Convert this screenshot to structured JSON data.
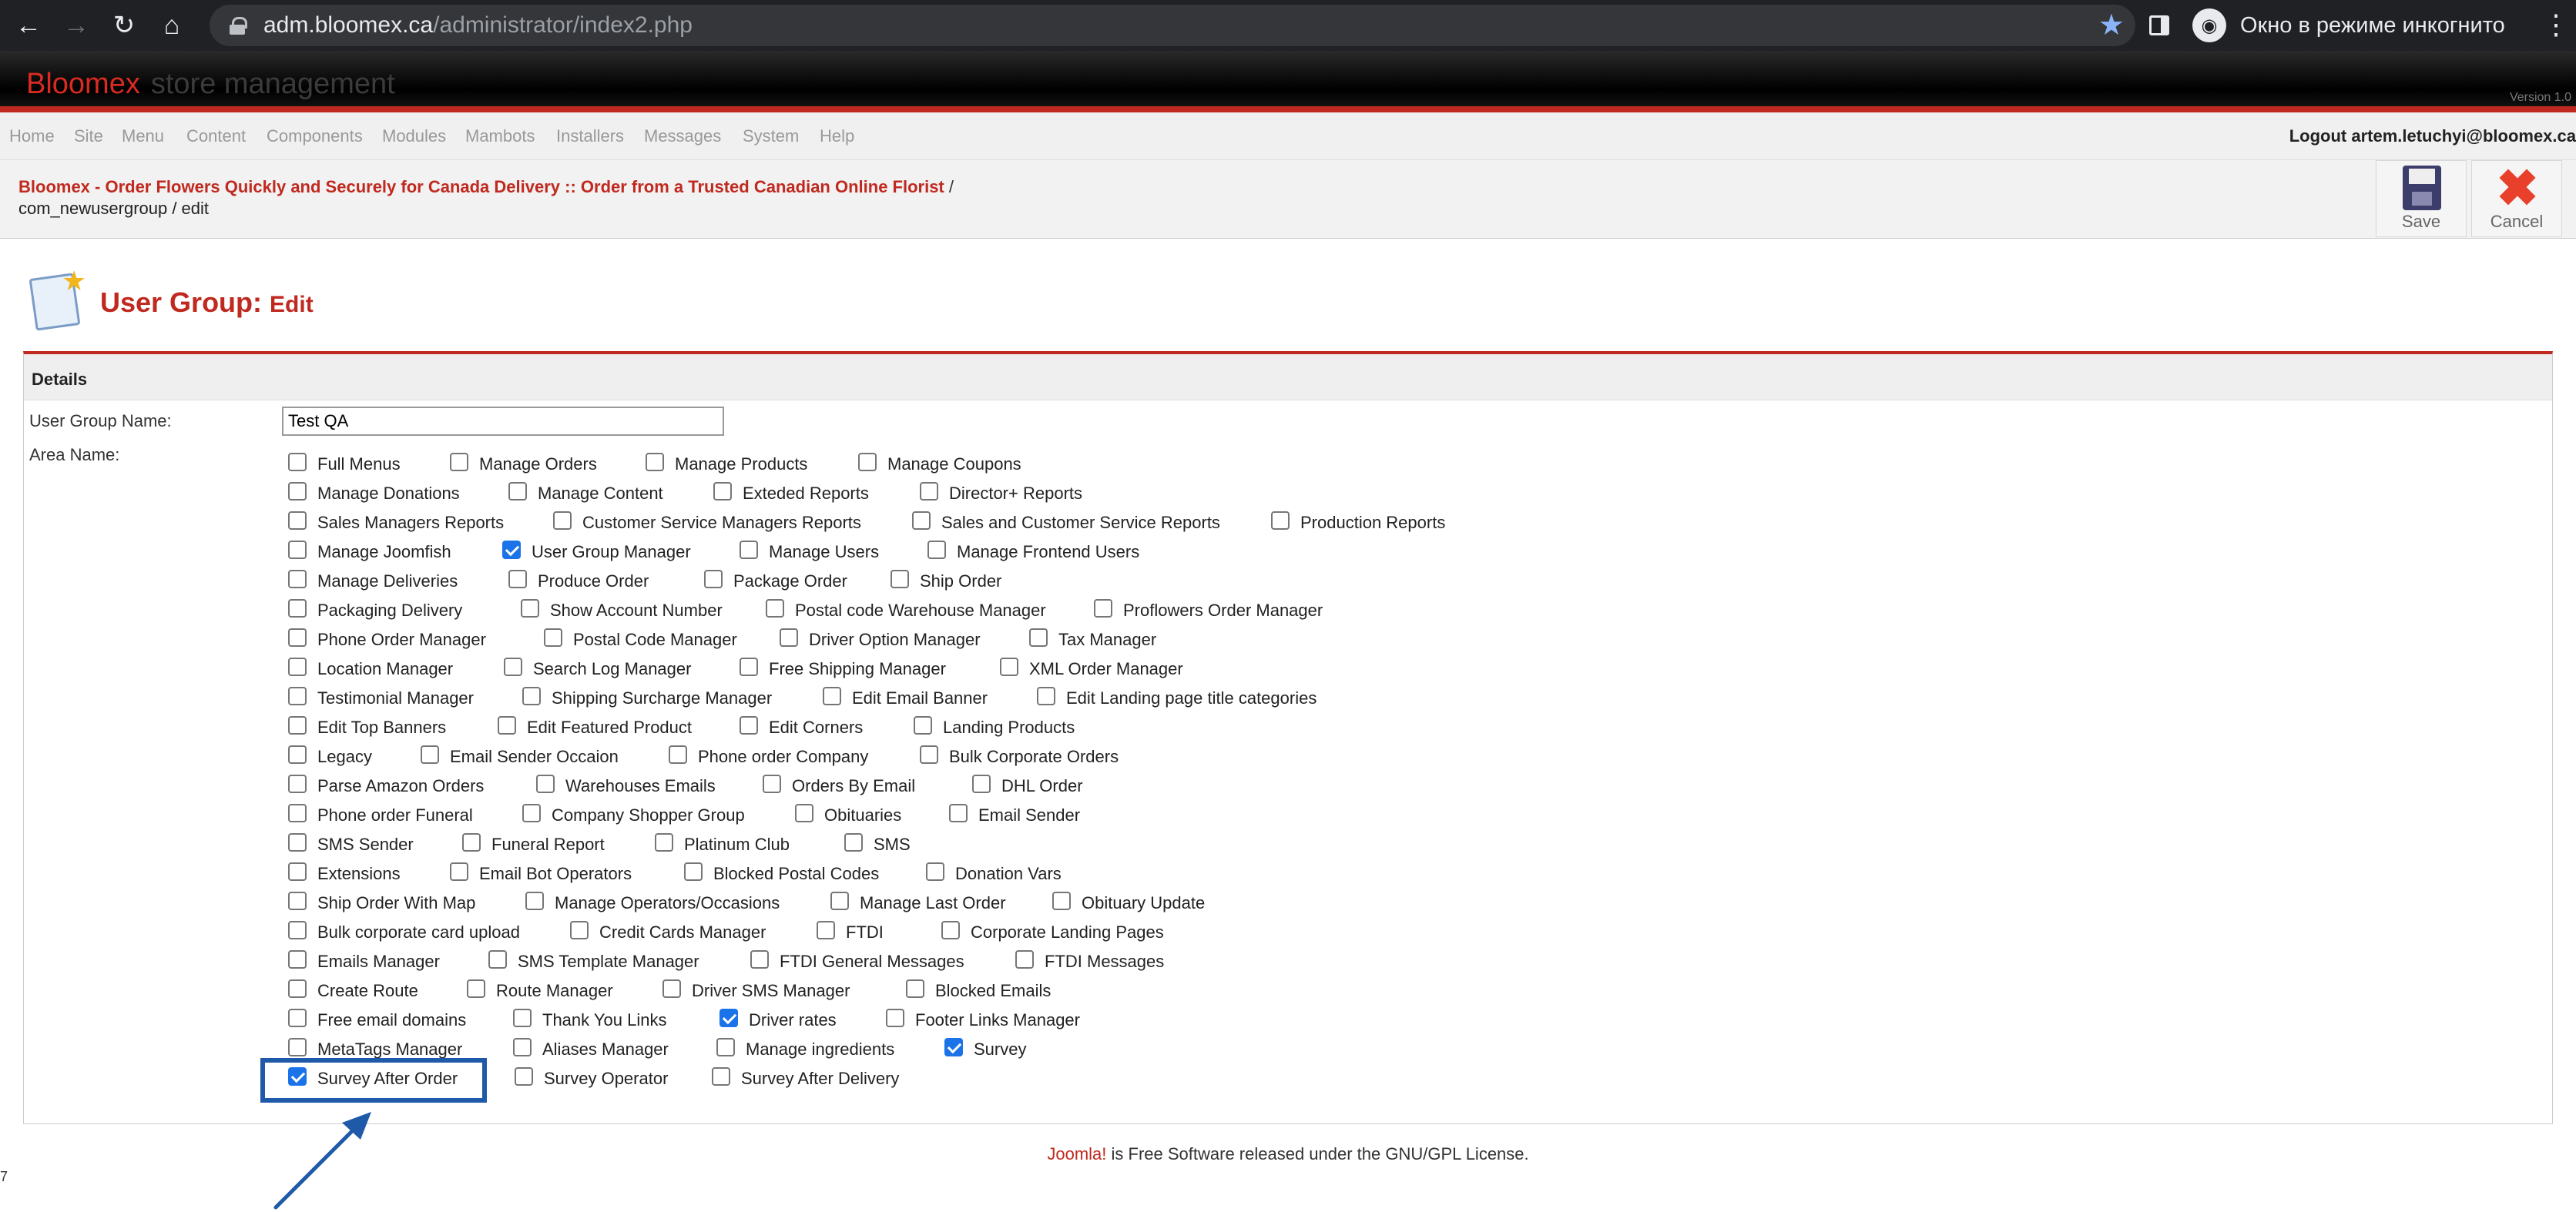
{
  "browser": {
    "url_host": "adm.bloomex.ca",
    "url_path": "/administrator/index2.php",
    "incognito_label": "Окно в режиме инкогнито"
  },
  "header": {
    "brand": "Bloomex",
    "brand_sub": "store management",
    "version": "Version 1.0"
  },
  "menu": {
    "items": [
      "Home",
      "Site",
      "Menu",
      "Content",
      "Components",
      "Modules",
      "Mambots",
      "Installers",
      "Messages",
      "System",
      "Help"
    ],
    "logout": "Logout artem.letuchyi@bloomex.ca"
  },
  "pathway": {
    "site_link": "Bloomex - Order Flowers Quickly and Securely for Canada Delivery :: Order from a Trusted Canadian Online Florist",
    "separator": "/",
    "current": "com_newusergroup / edit"
  },
  "toolbar": {
    "save": "Save",
    "cancel": "Cancel"
  },
  "page": {
    "title": "User Group:",
    "subtitle": "Edit"
  },
  "form": {
    "section": "Details",
    "name_label": "User Group Name:",
    "name_value": "Test QA",
    "area_label": "Area Name:",
    "rows": [
      [
        {
          "label": "Full Menus",
          "checked": false
        },
        {
          "label": "Manage Orders",
          "checked": false
        },
        {
          "label": "Manage Products",
          "checked": false
        },
        {
          "label": "Manage Coupons",
          "checked": false
        }
      ],
      [
        {
          "label": "Manage Donations",
          "checked": false
        },
        {
          "label": "Manage Content",
          "checked": false
        },
        {
          "label": "Exteded Reports",
          "checked": false
        },
        {
          "label": "Director+ Reports",
          "checked": false
        }
      ],
      [
        {
          "label": "Sales Managers Reports",
          "checked": false
        },
        {
          "label": "Customer Service Managers Reports",
          "checked": false
        },
        {
          "label": "Sales and Customer Service Reports",
          "checked": false
        },
        {
          "label": "Production Reports",
          "checked": false
        }
      ],
      [
        {
          "label": "Manage Joomfish",
          "checked": false
        },
        {
          "label": "User Group Manager",
          "checked": true
        },
        {
          "label": "Manage Users",
          "checked": false
        },
        {
          "label": "Manage Frontend Users",
          "checked": false
        }
      ],
      [
        {
          "label": "Manage Deliveries",
          "checked": false
        },
        {
          "label": "Produce Order",
          "checked": false
        },
        {
          "label": "Package Order",
          "checked": false
        },
        {
          "label": "Ship Order",
          "checked": false
        }
      ],
      [
        {
          "label": "Packaging Delivery",
          "checked": false
        },
        {
          "label": "Show Account Number",
          "checked": false
        },
        {
          "label": "Postal code Warehouse Manager",
          "checked": false
        },
        {
          "label": "Proflowers Order Manager",
          "checked": false
        }
      ],
      [
        {
          "label": "Phone Order Manager",
          "checked": false
        },
        {
          "label": "Postal Code Manager",
          "checked": false
        },
        {
          "label": "Driver Option Manager",
          "checked": false
        },
        {
          "label": "Tax Manager",
          "checked": false
        }
      ],
      [
        {
          "label": "Location Manager",
          "checked": false
        },
        {
          "label": "Search Log Manager",
          "checked": false
        },
        {
          "label": "Free Shipping Manager",
          "checked": false
        },
        {
          "label": "XML Order Manager",
          "checked": false
        }
      ],
      [
        {
          "label": "Testimonial Manager",
          "checked": false
        },
        {
          "label": "Shipping Surcharge Manager",
          "checked": false
        },
        {
          "label": "Edit Email Banner",
          "checked": false
        },
        {
          "label": "Edit Landing page title categories",
          "checked": false
        }
      ],
      [
        {
          "label": "Edit Top Banners",
          "checked": false
        },
        {
          "label": "Edit Featured Product",
          "checked": false
        },
        {
          "label": "Edit Corners",
          "checked": false
        },
        {
          "label": "Landing Products",
          "checked": false
        }
      ],
      [
        {
          "label": "Legacy",
          "checked": false
        },
        {
          "label": "Email Sender Occaion",
          "checked": false
        },
        {
          "label": "Phone order Company",
          "checked": false
        },
        {
          "label": "Bulk Corporate Orders",
          "checked": false
        }
      ],
      [
        {
          "label": "Parse Amazon Orders",
          "checked": false
        },
        {
          "label": "Warehouses Emails",
          "checked": false
        },
        {
          "label": "Orders By Email",
          "checked": false
        },
        {
          "label": "DHL Order",
          "checked": false
        }
      ],
      [
        {
          "label": "Phone order Funeral",
          "checked": false
        },
        {
          "label": "Company Shopper Group",
          "checked": false
        },
        {
          "label": "Obituaries",
          "checked": false
        },
        {
          "label": "Email Sender",
          "checked": false
        }
      ],
      [
        {
          "label": "SMS Sender",
          "checked": false
        },
        {
          "label": "Funeral Report",
          "checked": false
        },
        {
          "label": "Platinum Club",
          "checked": false
        },
        {
          "label": "SMS",
          "checked": false
        }
      ],
      [
        {
          "label": "Extensions",
          "checked": false
        },
        {
          "label": "Email Bot Operators",
          "checked": false
        },
        {
          "label": "Blocked Postal Codes",
          "checked": false
        },
        {
          "label": "Donation Vars",
          "checked": false
        }
      ],
      [
        {
          "label": "Ship Order With Map",
          "checked": false
        },
        {
          "label": "Manage Operators/Occasions",
          "checked": false
        },
        {
          "label": "Manage Last Order",
          "checked": false
        },
        {
          "label": "Obituary Update",
          "checked": false
        }
      ],
      [
        {
          "label": "Bulk corporate card upload",
          "checked": false
        },
        {
          "label": "Credit Cards Manager",
          "checked": false
        },
        {
          "label": "FTDI",
          "checked": false
        },
        {
          "label": "Corporate Landing Pages",
          "checked": false
        }
      ],
      [
        {
          "label": "Emails Manager",
          "checked": false
        },
        {
          "label": "SMS Template Manager",
          "checked": false
        },
        {
          "label": "FTDI General Messages",
          "checked": false
        },
        {
          "label": "FTDI Messages",
          "checked": false
        }
      ],
      [
        {
          "label": "Create Route",
          "checked": false
        },
        {
          "label": "Route Manager",
          "checked": false
        },
        {
          "label": "Driver SMS Manager",
          "checked": false
        },
        {
          "label": "Blocked Emails",
          "checked": false
        }
      ],
      [
        {
          "label": "Free email domains",
          "checked": false
        },
        {
          "label": "Thank You Links",
          "checked": false
        },
        {
          "label": "Driver rates",
          "checked": true
        },
        {
          "label": "Footer Links Manager",
          "checked": false
        }
      ],
      [
        {
          "label": "MetaTags Manager",
          "checked": false
        },
        {
          "label": "Aliases Manager",
          "checked": false
        },
        {
          "label": "Manage ingredients",
          "checked": false
        },
        {
          "label": "Survey",
          "checked": true
        }
      ],
      [
        {
          "label": "Survey After Order",
          "checked": true
        },
        {
          "label": "Survey Operator",
          "checked": false
        },
        {
          "label": "Survey After Delivery",
          "checked": false
        }
      ]
    ]
  },
  "footer": {
    "link": "Joomla!",
    "text": " is Free Software released under the GNU/GPL License."
  },
  "edge_mark": "7",
  "colors": {
    "accent": "#c0291f",
    "highlight": "#1e5aa8",
    "checkbox_checked": "#1a73e8"
  }
}
